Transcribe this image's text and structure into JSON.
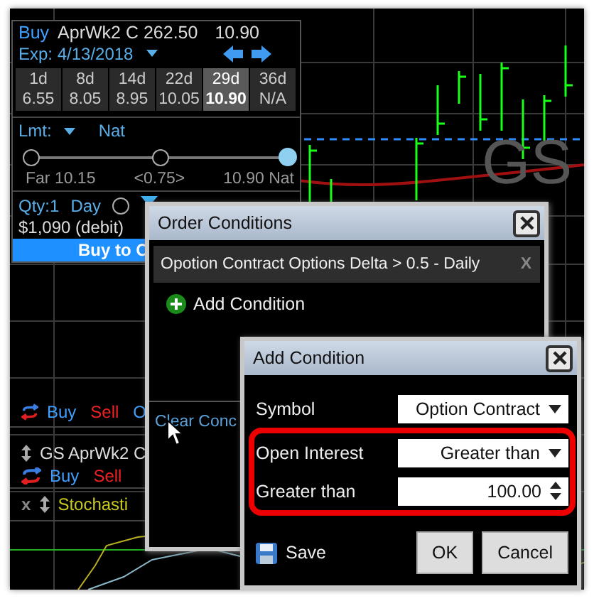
{
  "order_panel": {
    "side": "Buy",
    "contract": "AprWk2 C 262.50",
    "price": "10.90",
    "expiration": "Exp: 4/13/2018",
    "expirations": [
      {
        "days": "1d",
        "price": "6.55",
        "selected": false
      },
      {
        "days": "8d",
        "price": "8.05",
        "selected": false
      },
      {
        "days": "14d",
        "price": "8.95",
        "selected": false
      },
      {
        "days": "22d",
        "price": "10.05",
        "selected": false
      },
      {
        "days": "29d",
        "price": "10.90",
        "selected": true
      },
      {
        "days": "36d",
        "price": "N/A",
        "selected": false
      }
    ],
    "limit_label": "Lmt:",
    "limit_type": "Nat",
    "slider": {
      "level": 1,
      "labels": [
        "Far 10.15",
        "<0.75>",
        "10.90 Nat"
      ]
    },
    "quantity": "Qty:1",
    "duration": "Day",
    "confirm_checked": false,
    "cost": "$1,090 (debit)",
    "button": "Buy to C"
  },
  "chart": {
    "symbol": "GS"
  },
  "lower_panel": {
    "rows": [
      {
        "kind": "trade",
        "items": [
          "Buy",
          "Sell",
          "O"
        ]
      },
      {
        "kind": "title",
        "items": [
          "GS AprWk2 C"
        ]
      },
      {
        "kind": "trade",
        "items": [
          "Buy",
          "Sell"
        ]
      },
      {
        "kind": "study",
        "items": [
          "x",
          "Stochasti"
        ]
      }
    ]
  },
  "order_conditions": {
    "title": "Order Conditions",
    "conditions": [
      {
        "text": "Opotion Contract Options Delta > 0.5 - Daily",
        "remove": "X"
      }
    ],
    "add_label": "Add Condition",
    "clear_label": "Clear Conc"
  },
  "add_condition": {
    "title": "Add Condition",
    "fields": [
      {
        "label": "Symbol",
        "kind": "dropdown",
        "value": "Option Contract",
        "highlighted": false
      },
      {
        "label": "Open Interest",
        "kind": "dropdown",
        "value": "Greater than",
        "highlighted": true
      },
      {
        "label": "Greater than",
        "kind": "spinner",
        "value": "100.00",
        "highlighted": true
      }
    ],
    "save_label": "Save",
    "buttons": [
      "OK",
      "Cancel"
    ]
  }
}
